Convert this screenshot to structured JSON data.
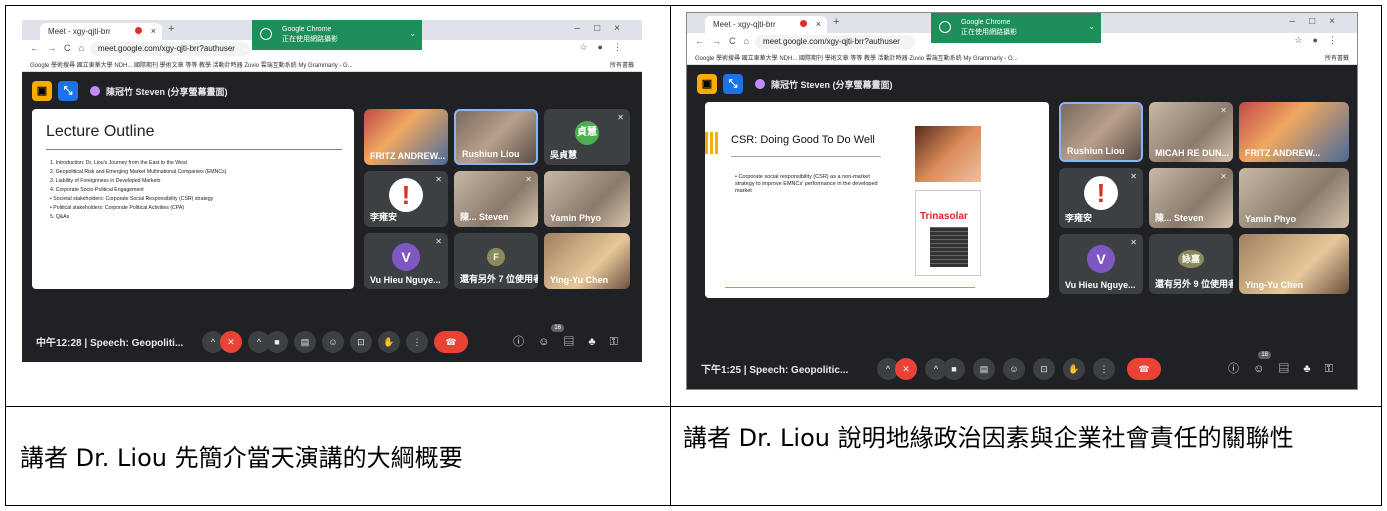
{
  "captions": {
    "left": "講者 Dr. Liou 先簡介當天演講的大綱概要",
    "right": "講者 Dr. Liou 說明地緣政治因素與企業社會責任的關聯性"
  },
  "browser": {
    "tab_title": "Meet - xgy-qjti-brr",
    "url1": "meet.google.com/xgy-qjti-brr?authuser",
    "url2": "meet.google.com/xgy-qjti-brr?authuser",
    "bookmarks": "Google 學術搜尋   國立東華大學 NDH...   國際期刊   學術文章   等等   教學   活動計時器   Zuvio 雲端互動系統   My Grammarly - G...",
    "bookmarks_right": "所有書籤",
    "toast_title": "Google Chrome",
    "toast_sub": "正在使用網路攝影"
  },
  "presenter": "陳冠竹 Steven (分享螢幕畫面)",
  "meet1": {
    "time": "中午12:28",
    "meeting": "Speech: Geopoliti...",
    "people_count": "16",
    "tiles": [
      "FRITZ ANDREW...",
      "Rushiun Liou",
      "吳貞慧",
      "李雍安",
      "陳... Steven",
      "Yamin Phyo",
      "Vu Hieu Nguye...",
      "還有另外 7 位使用者",
      "Ying-Yu Chen"
    ],
    "tile_initials": {
      "wu": "貞慧",
      "vu": "V",
      "more": "F"
    },
    "slide": {
      "title": "Lecture Outline",
      "items": [
        "1.   Introduction: Dr. Liou's Journey from the East to the West",
        "2.   Geopolitical Risk and Emerging Market Multinational Companies (EMNCs)",
        "3.   Liability of Foreignness in Developed Markets",
        "4.   Corporate Socio-Political Engagement",
        "       • Societal stakeholders: Corporate Social Responsibility (CSR) strategy",
        "       • Political stakeholders: Corporate Political Activities (CPA)",
        "5.   Q&As"
      ]
    }
  },
  "meet2": {
    "time": "下午1:25",
    "meeting": "Speech: Geopolitic...",
    "people_count": "18",
    "tiles": [
      "Rushiun Liou",
      "MICAH RE DUN...",
      "FRITZ ANDREW...",
      "李雍安",
      "陳... Steven",
      "Yamin Phyo",
      "Vu Hieu Nguye...",
      "還有另外 9 位使用者",
      "Ying-Yu Chen"
    ],
    "tile_initials": {
      "vu": "V",
      "more": "詠嘉"
    },
    "slide": {
      "title": "CSR: Doing Good To Do Well",
      "body": "• Corporate social responsibility (CSR) as a non-market strategy to improve EMNCs' performance in the developed market",
      "logo_a": "Trina",
      "logo_b": "solar"
    }
  },
  "colors": {
    "meet_bg": "#202124",
    "end_call": "#ea4335",
    "toast": "#1e8e5a"
  }
}
